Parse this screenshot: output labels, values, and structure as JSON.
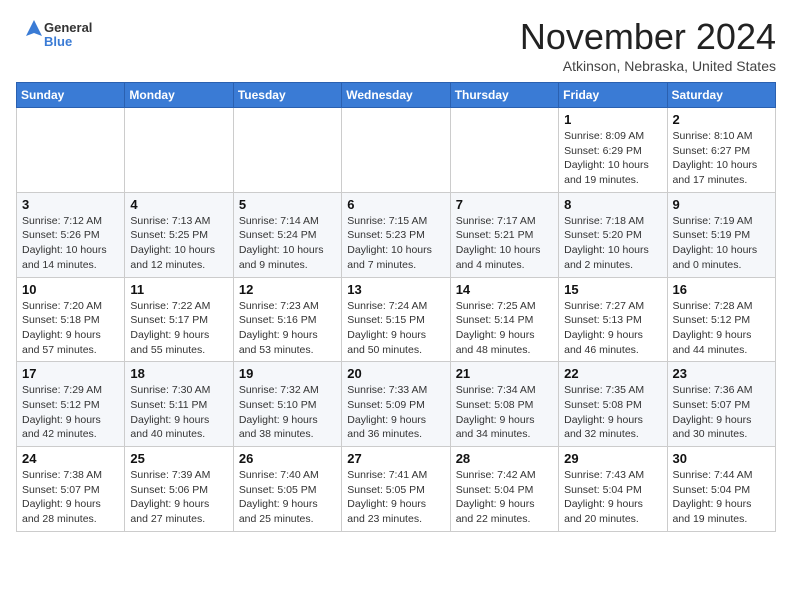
{
  "logo": {
    "general": "General",
    "blue": "Blue"
  },
  "header": {
    "title": "November 2024",
    "subtitle": "Atkinson, Nebraska, United States"
  },
  "weekdays": [
    "Sunday",
    "Monday",
    "Tuesday",
    "Wednesday",
    "Thursday",
    "Friday",
    "Saturday"
  ],
  "weeks": [
    [
      {
        "day": "",
        "info": ""
      },
      {
        "day": "",
        "info": ""
      },
      {
        "day": "",
        "info": ""
      },
      {
        "day": "",
        "info": ""
      },
      {
        "day": "",
        "info": ""
      },
      {
        "day": "1",
        "info": "Sunrise: 8:09 AM\nSunset: 6:29 PM\nDaylight: 10 hours and 19 minutes."
      },
      {
        "day": "2",
        "info": "Sunrise: 8:10 AM\nSunset: 6:27 PM\nDaylight: 10 hours and 17 minutes."
      }
    ],
    [
      {
        "day": "3",
        "info": "Sunrise: 7:12 AM\nSunset: 5:26 PM\nDaylight: 10 hours and 14 minutes."
      },
      {
        "day": "4",
        "info": "Sunrise: 7:13 AM\nSunset: 5:25 PM\nDaylight: 10 hours and 12 minutes."
      },
      {
        "day": "5",
        "info": "Sunrise: 7:14 AM\nSunset: 5:24 PM\nDaylight: 10 hours and 9 minutes."
      },
      {
        "day": "6",
        "info": "Sunrise: 7:15 AM\nSunset: 5:23 PM\nDaylight: 10 hours and 7 minutes."
      },
      {
        "day": "7",
        "info": "Sunrise: 7:17 AM\nSunset: 5:21 PM\nDaylight: 10 hours and 4 minutes."
      },
      {
        "day": "8",
        "info": "Sunrise: 7:18 AM\nSunset: 5:20 PM\nDaylight: 10 hours and 2 minutes."
      },
      {
        "day": "9",
        "info": "Sunrise: 7:19 AM\nSunset: 5:19 PM\nDaylight: 10 hours and 0 minutes."
      }
    ],
    [
      {
        "day": "10",
        "info": "Sunrise: 7:20 AM\nSunset: 5:18 PM\nDaylight: 9 hours and 57 minutes."
      },
      {
        "day": "11",
        "info": "Sunrise: 7:22 AM\nSunset: 5:17 PM\nDaylight: 9 hours and 55 minutes."
      },
      {
        "day": "12",
        "info": "Sunrise: 7:23 AM\nSunset: 5:16 PM\nDaylight: 9 hours and 53 minutes."
      },
      {
        "day": "13",
        "info": "Sunrise: 7:24 AM\nSunset: 5:15 PM\nDaylight: 9 hours and 50 minutes."
      },
      {
        "day": "14",
        "info": "Sunrise: 7:25 AM\nSunset: 5:14 PM\nDaylight: 9 hours and 48 minutes."
      },
      {
        "day": "15",
        "info": "Sunrise: 7:27 AM\nSunset: 5:13 PM\nDaylight: 9 hours and 46 minutes."
      },
      {
        "day": "16",
        "info": "Sunrise: 7:28 AM\nSunset: 5:12 PM\nDaylight: 9 hours and 44 minutes."
      }
    ],
    [
      {
        "day": "17",
        "info": "Sunrise: 7:29 AM\nSunset: 5:12 PM\nDaylight: 9 hours and 42 minutes."
      },
      {
        "day": "18",
        "info": "Sunrise: 7:30 AM\nSunset: 5:11 PM\nDaylight: 9 hours and 40 minutes."
      },
      {
        "day": "19",
        "info": "Sunrise: 7:32 AM\nSunset: 5:10 PM\nDaylight: 9 hours and 38 minutes."
      },
      {
        "day": "20",
        "info": "Sunrise: 7:33 AM\nSunset: 5:09 PM\nDaylight: 9 hours and 36 minutes."
      },
      {
        "day": "21",
        "info": "Sunrise: 7:34 AM\nSunset: 5:08 PM\nDaylight: 9 hours and 34 minutes."
      },
      {
        "day": "22",
        "info": "Sunrise: 7:35 AM\nSunset: 5:08 PM\nDaylight: 9 hours and 32 minutes."
      },
      {
        "day": "23",
        "info": "Sunrise: 7:36 AM\nSunset: 5:07 PM\nDaylight: 9 hours and 30 minutes."
      }
    ],
    [
      {
        "day": "24",
        "info": "Sunrise: 7:38 AM\nSunset: 5:07 PM\nDaylight: 9 hours and 28 minutes."
      },
      {
        "day": "25",
        "info": "Sunrise: 7:39 AM\nSunset: 5:06 PM\nDaylight: 9 hours and 27 minutes."
      },
      {
        "day": "26",
        "info": "Sunrise: 7:40 AM\nSunset: 5:05 PM\nDaylight: 9 hours and 25 minutes."
      },
      {
        "day": "27",
        "info": "Sunrise: 7:41 AM\nSunset: 5:05 PM\nDaylight: 9 hours and 23 minutes."
      },
      {
        "day": "28",
        "info": "Sunrise: 7:42 AM\nSunset: 5:04 PM\nDaylight: 9 hours and 22 minutes."
      },
      {
        "day": "29",
        "info": "Sunrise: 7:43 AM\nSunset: 5:04 PM\nDaylight: 9 hours and 20 minutes."
      },
      {
        "day": "30",
        "info": "Sunrise: 7:44 AM\nSunset: 5:04 PM\nDaylight: 9 hours and 19 minutes."
      }
    ]
  ]
}
